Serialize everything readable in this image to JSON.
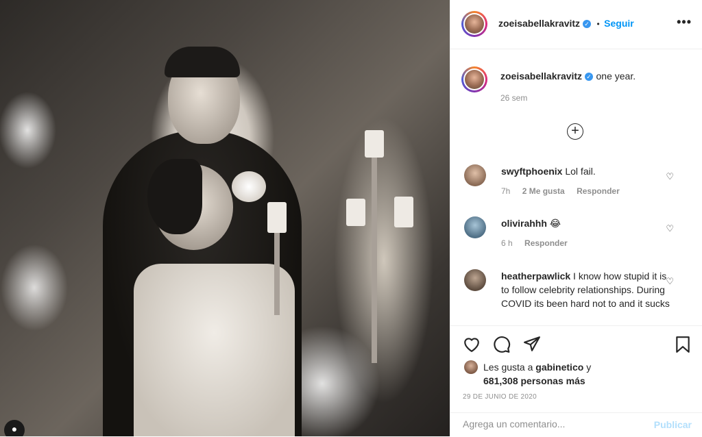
{
  "post": {
    "image_alt": "photo",
    "username": "zoeisabellakravitz",
    "follow_label": "Seguir",
    "more_label": "•••",
    "caption": "one year.",
    "caption_time": "26 sem",
    "load_more_icon": "plus-circle-icon"
  },
  "comments": [
    {
      "username": "swyftphoenix",
      "text": "Lol fail.",
      "time": "7h",
      "likes": "2 Me gusta",
      "reply": "Responder",
      "avatar_color": "#c9a38b"
    },
    {
      "username": "olivirahhh",
      "text": "😂",
      "time": "6 h",
      "likes": "",
      "reply": "Responder",
      "avatar_color": "#6f8fa8"
    },
    {
      "username": "heatherpawlick",
      "text": "I know how stupid it is to follow celebrity relationships. During COVID its been hard not to and it sucks",
      "time": "",
      "likes": "",
      "reply": "",
      "avatar_color": "#7c6a5d"
    }
  ],
  "actions": {
    "like_icon": "heart-icon",
    "comment_icon": "comment-icon",
    "share_icon": "send-icon",
    "save_icon": "bookmark-icon"
  },
  "likes": {
    "prefix": "Les gusta a",
    "user": "gabinetico",
    "connector": "y",
    "count": "681,308 personas más"
  },
  "date": "29 DE JUNIO DE 2020",
  "comment_box": {
    "placeholder": "Agrega un comentario...",
    "publish_label": "Publicar"
  },
  "colors": {
    "accent": "#0095f6",
    "publish_disabled": "#b2dffc",
    "verified": "#3897f0"
  }
}
